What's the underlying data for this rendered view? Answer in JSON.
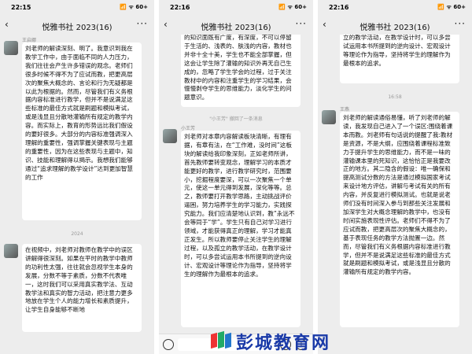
{
  "chat_title": "悦雅书社 2023(16)",
  "back_icon": "‹",
  "more_icon": "···",
  "phones": [
    {
      "time": "22:15",
      "signal": "📶 ᯤ 60+",
      "messages": [
        {
          "sender": "王启娜",
          "text": "刘老师的解读深刻、明了。我意识到我在教学工作中，由于面临不同的人力压力，我们往往会产生许多错误的观念。老师们很多时候不得不为了应试而教，把更高层次的聚焦大概念的、言论和行为无疑都是以此为根据的。然而，尽管我们有义务根据内容标准进行教学，但并不是说满足这些标准的最佳方式就是刷题和模拟考试，或是浅显且分散地灌输所有规定的教学内容。而实际上，教育的形势远比我们假设的要好很多。大部分的内容标准强调深入理解的重要性，强调掌握关键表现与主题的重要性，因为在这些表现与主题中，知识、技能和理解得以揭示。我想我们能够通过“追求理解的教学设计”达到更加智慧的工作"
        },
        {
          "time": "2024",
          "sender": "",
          "text": "在视频中，刘老师对教师在教学中的误区讲解得很深刻。如果在平时的教学中教师的功利性太强，往往就会忽视学生本身的发展，分数不等于素质，分数不代表唯一，这时我们可以采用真实教学法、互动教学法和真实的智力活动，把注意力更多地放在学生个人的能力增长和素质提升，让学生自身能够不断地"
        }
      ]
    },
    {
      "time": "22:16",
      "signal": "📶 ᯤ 60+",
      "messages": [
        {
          "sender": "",
          "text": "的知识面既有广度，有深度，不可以停留于生活的、浅表的、肤浅的内容，教材也并非十全十美，学生也不能全部掌握，但这会让学生除了灌输的知识外再无自己生成的，忽略了学生学会的过程，过于关注教材中的内容和注重学生的学习结果，会慢慢剥夺学生的思维能力，淡化学生的问题意识。"
        },
        {
          "system": "\"小王芳\" 撤回了一条消息"
        },
        {
          "sender": "小王芳",
          "text": "刘老师对本章内容解读板块清晰，有理有据，有章有法，在“工作难，没时间”这板块的解读给我印象深刻，正如老师所讲，首先教师要转变观念，理解学习的本质才能更好的教学，进行教学研究时，范围要小，挖掘程度要深，可以一次聚焦一个单元，使这一单元得到发展，深化等等。总之，教师要打开教学思路，主动挑战评价逼困，努力培养学生的学习能力，实践探究能力。我们应清楚地认识到，教”永远不会等同于“学”。学生只有自己对学习进行领域，才能获得真正的理解，学习才能真正发生。所以教师要停止关注学生的理解过程，以及孤立的教学活动，在教学设计时，可以多尝试运用本书所提到的逆向设计、宏观设计等理论作为指导，坚持将学生的理解作为最根本的追求。"
        }
      ]
    },
    {
      "time": "22:16",
      "signal": "📶 ᯤ 60+",
      "messages": [
        {
          "sender": "",
          "text": "立的教学活动，在教学设计时，可以多尝试运用本书所提到的逆向设计、宏观设计等理论作为指导，坚持将学生的理解作为最根本的追求。"
        },
        {
          "time": "16:58",
          "sender": "王燕",
          "text": "刘老师的解读通俗易懂，听了刘老师的解读，我发现自己进入了一个误区:围绕着课本而教。刘老师有句话说的提醒了我:教材是资源，不是大纲，应围绕着课程标准致力于提升学生的思维能力，而不是一味的灌输课本里的死知识，这恰恰正是我要改正的地方。其二隐含的假设：唯一确保和提高测试分数的方法是通过模拟国家考试来设计地方评估，讲解与考试有关的所有内容，并反复进行模拟测试。也就是说老师们没有时间深入参与到那些关注发展和加深学生对大概念理解的教学中，也没有时间实施表现性评估。老师们不得不为了应试而教，把更高层次的聚焦大概念的，基于表现任务的教学方法抛置一边。然而，尽管我们有义务根据内容标准进行教学，但并不是说满足这些标准的最佳方式就是刷题和模拟考试，或是浅显且分散的灌输所有规定的教学内容。"
        }
      ]
    }
  ],
  "watermark_text": "彭城教育网"
}
